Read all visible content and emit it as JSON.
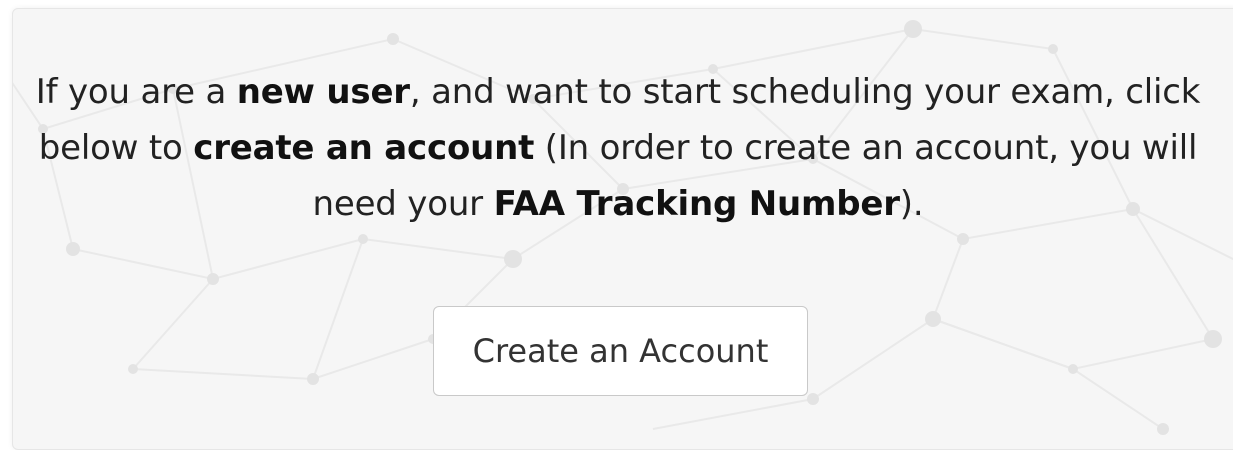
{
  "intro": {
    "part1": "If you are a ",
    "bold1": "new user",
    "part2": ", and want to start scheduling your exam, click below to ",
    "bold2": "create an account",
    "part3": " (In order to create an account, you will need your ",
    "bold3": "FAA Tracking Number",
    "part4": ")."
  },
  "actions": {
    "create_account_label": "Create an Account"
  },
  "colors": {
    "card_background": "#f6f6f6",
    "button_background": "#ffffff",
    "button_border": "#c9c9c9",
    "text": "#222222"
  }
}
